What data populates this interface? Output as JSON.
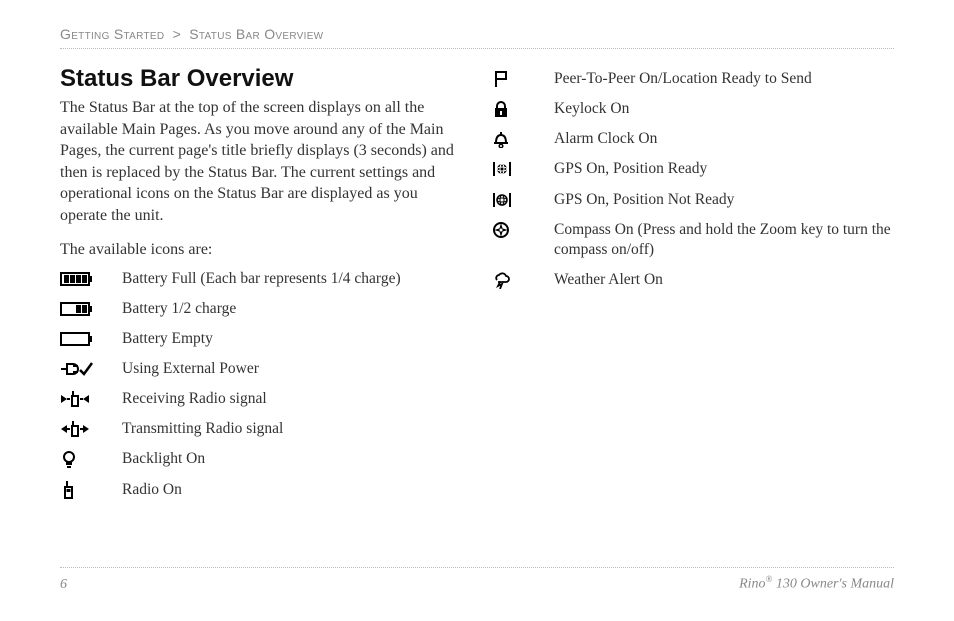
{
  "breadcrumb": {
    "section": "Getting Started",
    "separator": ">",
    "page": "Status Bar Overview"
  },
  "heading": "Status Bar Overview",
  "intro": "The Status Bar at the top of the screen displays on all the available Main Pages. As you move around any of the Main Pages, the current page's title briefly displays (3 seconds) and then is replaced by the Status Bar. The current settings and operational icons on the Status Bar are displayed as you operate the unit.",
  "lead": "The available icons are:",
  "left_icons": [
    {
      "icon": "battery-full-icon",
      "desc": "Battery Full (Each bar represents 1/4 charge)"
    },
    {
      "icon": "battery-half-icon",
      "desc": "Battery 1/2 charge"
    },
    {
      "icon": "battery-empty-icon",
      "desc": "Battery Empty"
    },
    {
      "icon": "external-power-icon",
      "desc": "Using External Power"
    },
    {
      "icon": "radio-receiving-icon",
      "desc": "Receiving Radio signal"
    },
    {
      "icon": "radio-transmitting-icon",
      "desc": "Transmitting Radio signal"
    },
    {
      "icon": "backlight-on-icon",
      "desc": "Backlight On"
    },
    {
      "icon": "radio-on-icon",
      "desc": "Radio On"
    }
  ],
  "right_icons": [
    {
      "icon": "flag-icon",
      "desc": "Peer-To-Peer On/Location Ready to Send"
    },
    {
      "icon": "keylock-icon",
      "desc": "Keylock On"
    },
    {
      "icon": "alarm-clock-icon",
      "desc": "Alarm Clock On"
    },
    {
      "icon": "gps-ready-icon",
      "desc": "GPS On, Position Ready"
    },
    {
      "icon": "gps-not-ready-icon",
      "desc": "GPS On, Position Not Ready"
    },
    {
      "icon": "compass-icon",
      "desc": "Compass On (Press and hold the Zoom key to turn the compass on/off)"
    },
    {
      "icon": "weather-alert-icon",
      "desc": "Weather Alert On"
    }
  ],
  "footer": {
    "page_number": "6",
    "manual_title_prefix": "Rino",
    "manual_title_suffix": " 130 Owner's Manual"
  }
}
